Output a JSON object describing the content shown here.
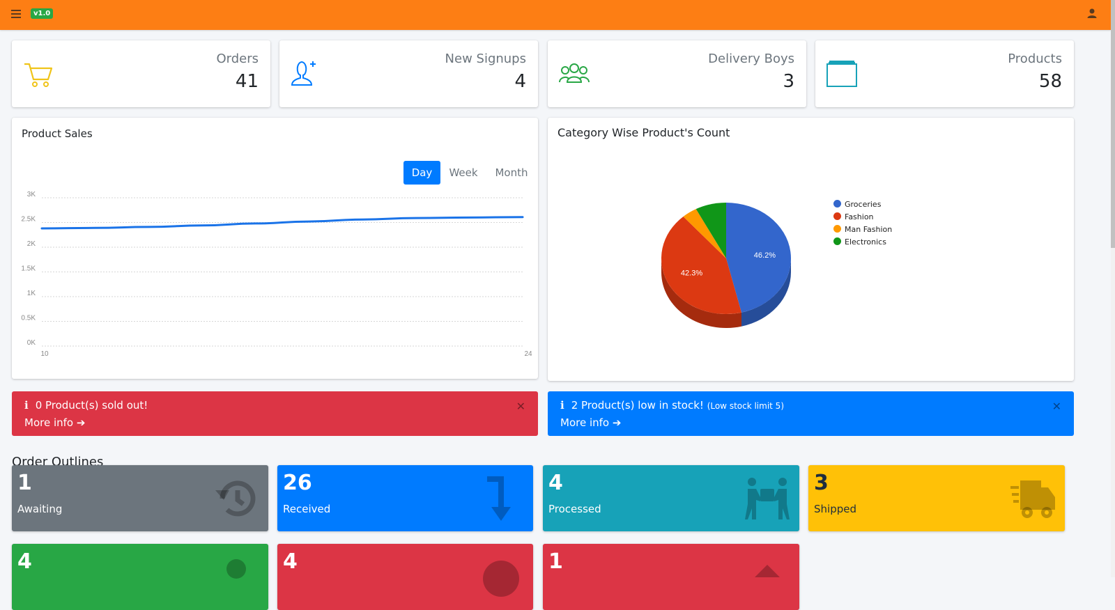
{
  "header": {
    "version": "v1.0"
  },
  "stats": [
    {
      "label": "Orders",
      "value": "41",
      "icon": "cart-icon",
      "color": "#f0c419"
    },
    {
      "label": "New Signups",
      "value": "4",
      "icon": "user-plus-icon",
      "color": "#007bff"
    },
    {
      "label": "Delivery Boys",
      "value": "3",
      "icon": "users-icon",
      "color": "#28a745"
    },
    {
      "label": "Products",
      "value": "58",
      "icon": "box-icon",
      "color": "#17a2b8"
    }
  ],
  "product_sales": {
    "title": "Product Sales",
    "tabs": [
      "Day",
      "Week",
      "Month"
    ],
    "active_tab": "Day"
  },
  "category_chart": {
    "title": "Category Wise Product's Count"
  },
  "chart_data": [
    {
      "type": "line",
      "x": [
        10,
        24
      ],
      "x_ticks": [
        "10",
        "24"
      ],
      "y_ticks": [
        "3K",
        "2.5K",
        "2K",
        "1.5K",
        "1K",
        "0.5K",
        "0K"
      ],
      "ylim": [
        0,
        3000
      ],
      "series": [
        {
          "values": [
            2380,
            2390,
            2410,
            2440,
            2480,
            2520,
            2560,
            2590,
            2600,
            2610
          ],
          "color": "#1a73e8"
        }
      ],
      "grid": true
    },
    {
      "type": "pie",
      "labels": [
        "Groceries",
        "Fashion",
        "Man Fashion",
        "Electronics"
      ],
      "values": [
        46.2,
        42.3,
        3.8,
        7.7
      ],
      "value_labels": [
        "46.2%",
        "42.3%"
      ],
      "colors": [
        "#3366cc",
        "#dc3912",
        "#ff9900",
        "#109618"
      ],
      "legend": "right"
    }
  ],
  "alerts": [
    {
      "message": "0 Product(s) sold out!",
      "note": "",
      "more": "More info",
      "color": "#dc3545"
    },
    {
      "message": "2 Product(s) low in stock!",
      "note": "(Low stock limit 5)",
      "more": "More info",
      "color": "#007bff"
    }
  ],
  "order_outlines": {
    "title": "Order Outlines",
    "boxes": [
      {
        "count": "1",
        "label": "Awaiting",
        "icon": "history-icon",
        "color": "#6c757d"
      },
      {
        "count": "26",
        "label": "Received",
        "icon": "arrow-down-icon",
        "color": "#007bff"
      },
      {
        "count": "4",
        "label": "Processed",
        "icon": "people-carry-icon",
        "color": "#17a2b8"
      },
      {
        "count": "3",
        "label": "Shipped",
        "icon": "truck-icon",
        "color": "#ffc107"
      },
      {
        "count": "4",
        "label": "",
        "icon": "user-icon",
        "color": "#28a745"
      },
      {
        "count": "4",
        "label": "",
        "icon": "circle-icon",
        "color": "#dc3545"
      },
      {
        "count": "1",
        "label": "",
        "icon": "arrow-up-icon",
        "color": "#dc3545"
      }
    ]
  }
}
